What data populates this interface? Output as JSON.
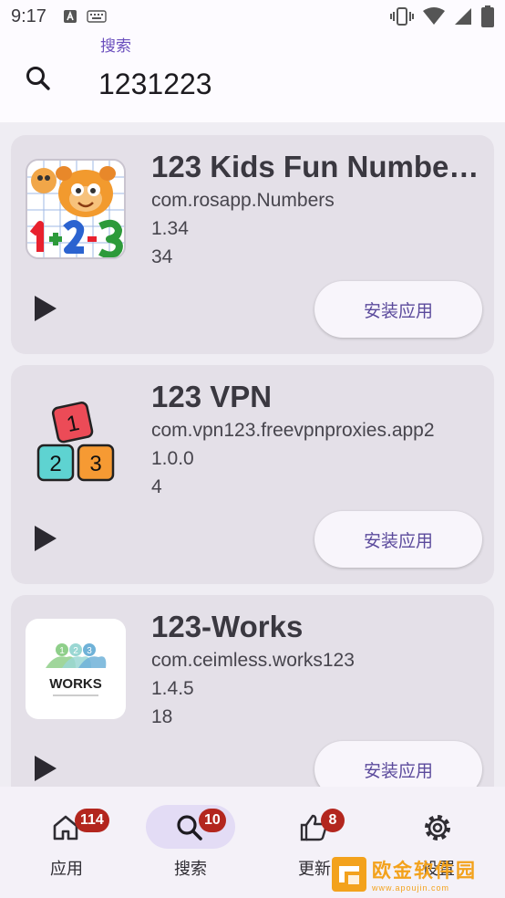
{
  "status_bar": {
    "time": "9:17"
  },
  "search": {
    "floating_label": "搜索",
    "value": "1231223",
    "icon": "search-icon"
  },
  "apps": [
    {
      "name": "123 Kids Fun Number…",
      "package": "com.rosapp.Numbers",
      "version": "1.34",
      "version_code": "34",
      "install_label": "安装应用"
    },
    {
      "name": "123 VPN",
      "package": "com.vpn123.freevpnproxies.app2",
      "version": "1.0.0",
      "version_code": "4",
      "install_label": "安装应用"
    },
    {
      "name": "123-Works",
      "package": "com.ceimless.works123",
      "version": "1.4.5",
      "version_code": "18",
      "install_label": "安装应用"
    }
  ],
  "works_logo": {
    "digits": [
      "1",
      "2",
      "3"
    ],
    "word": "WORKS"
  },
  "vpn_logo": {
    "digits": [
      "1",
      "2",
      "3"
    ]
  },
  "nav": [
    {
      "label": "应用",
      "badge": "114",
      "icon": "home-icon",
      "active": false
    },
    {
      "label": "搜索",
      "badge": "10",
      "icon": "search-icon",
      "active": true
    },
    {
      "label": "更新",
      "badge": "8",
      "icon": "thumbs-up-icon",
      "active": false
    },
    {
      "label": "设置",
      "badge": "",
      "icon": "gear-icon",
      "active": false
    }
  ],
  "watermark": {
    "title": "欧金软件园",
    "subtitle": "www.apoujin.com"
  },
  "colors": {
    "accent": "#6b4fbe",
    "card": "#e4e0e8",
    "badge": "#b3261e",
    "active_nav_pill": "#e3dcf5",
    "watermark": "#f3a21c"
  }
}
